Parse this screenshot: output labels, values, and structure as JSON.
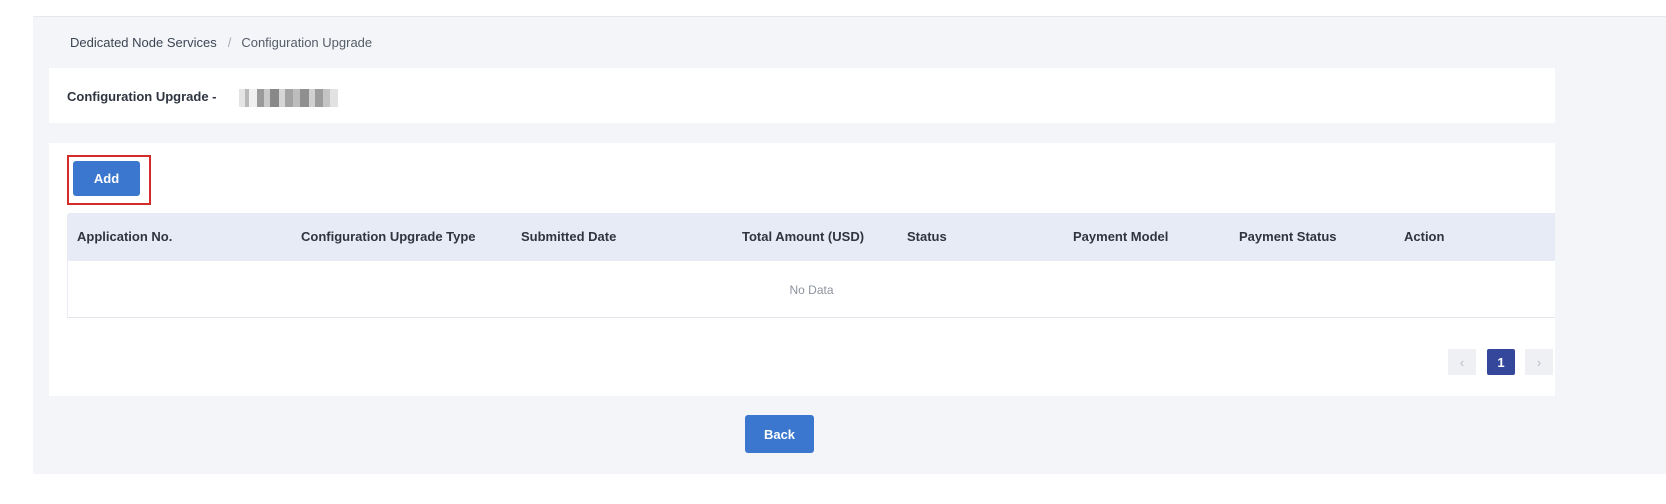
{
  "breadcrumb": {
    "parent": "Dedicated Node Services",
    "separator": "/",
    "current": "Configuration Upgrade"
  },
  "header": {
    "title": "Configuration Upgrade -"
  },
  "toolbar": {
    "add_label": "Add"
  },
  "table": {
    "columns": [
      "Application No.",
      "Configuration Upgrade Type",
      "Submitted Date",
      "Total Amount (USD)",
      "Status",
      "Payment Model",
      "Payment Status",
      "Action"
    ],
    "empty_text": "No Data"
  },
  "pagination": {
    "prev_icon": "chevron-left-icon",
    "current_page": "1",
    "next_icon": "chevron-right-icon"
  },
  "footer": {
    "back_label": "Back"
  },
  "colors": {
    "primary": "#3b77cf",
    "page_active": "#34479a",
    "highlight": "#d32a2a",
    "table_header_bg": "#e6ebf5"
  }
}
